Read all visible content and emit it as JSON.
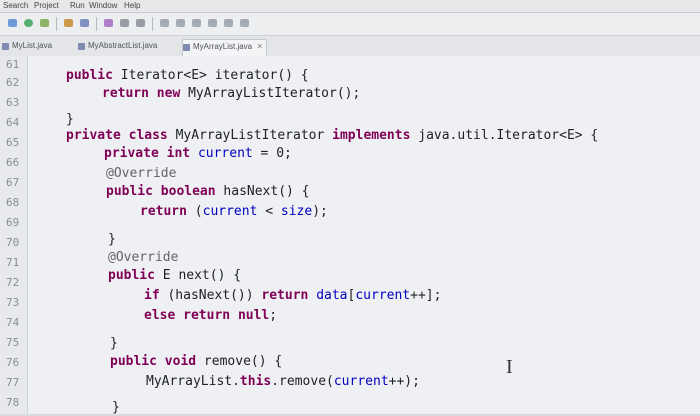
{
  "menubar": {
    "items": [
      "Search",
      "Project",
      "Run",
      "Window",
      "Help"
    ]
  },
  "toolbar": {
    "icons": [
      "back-icon",
      "run-icon",
      "debug-icon",
      "build-icon",
      "search-icon",
      "open-type-icon",
      "prev-edit-icon",
      "next-edit-icon"
    ]
  },
  "tabs": [
    {
      "label": "MyList.java",
      "active": false
    },
    {
      "label": "MyAbstractList.java",
      "active": false
    },
    {
      "label": "MyArrayList.java",
      "active": true,
      "close": "✕"
    }
  ],
  "editor": {
    "line_numbers": [
      "61",
      "62",
      "63",
      "64",
      "65",
      "66",
      "67",
      "68",
      "69",
      "70",
      "71",
      "72",
      "73",
      "74",
      "75",
      "76",
      "77",
      "78"
    ],
    "lines": [
      [
        "public Iterator<E> iterator() {"
      ],
      [
        "return new MyArrayListIterator();"
      ],
      [
        "}"
      ],
      [
        "private class MyArrayListIterator implements java.util.Iterator<E> {"
      ],
      [
        "private int current = 0;"
      ],
      [
        "@Override"
      ],
      [
        "public boolean hasNext() {"
      ],
      [
        "return (current < size);"
      ],
      [
        "}"
      ],
      [
        "@Override"
      ],
      [
        "public E next() {"
      ],
      [
        "if (hasNext()) return data[current++];"
      ],
      [
        "else return null;"
      ],
      [
        "}"
      ],
      [
        "public void remove() {"
      ],
      [
        "MyArrayList.this.remove(current++);"
      ],
      [
        "}"
      ]
    ]
  },
  "colors": {
    "keyword": "#7f0055",
    "annotation": "#646464",
    "field": "#0000c0",
    "background": "#eef0f3"
  },
  "cursor": "I"
}
